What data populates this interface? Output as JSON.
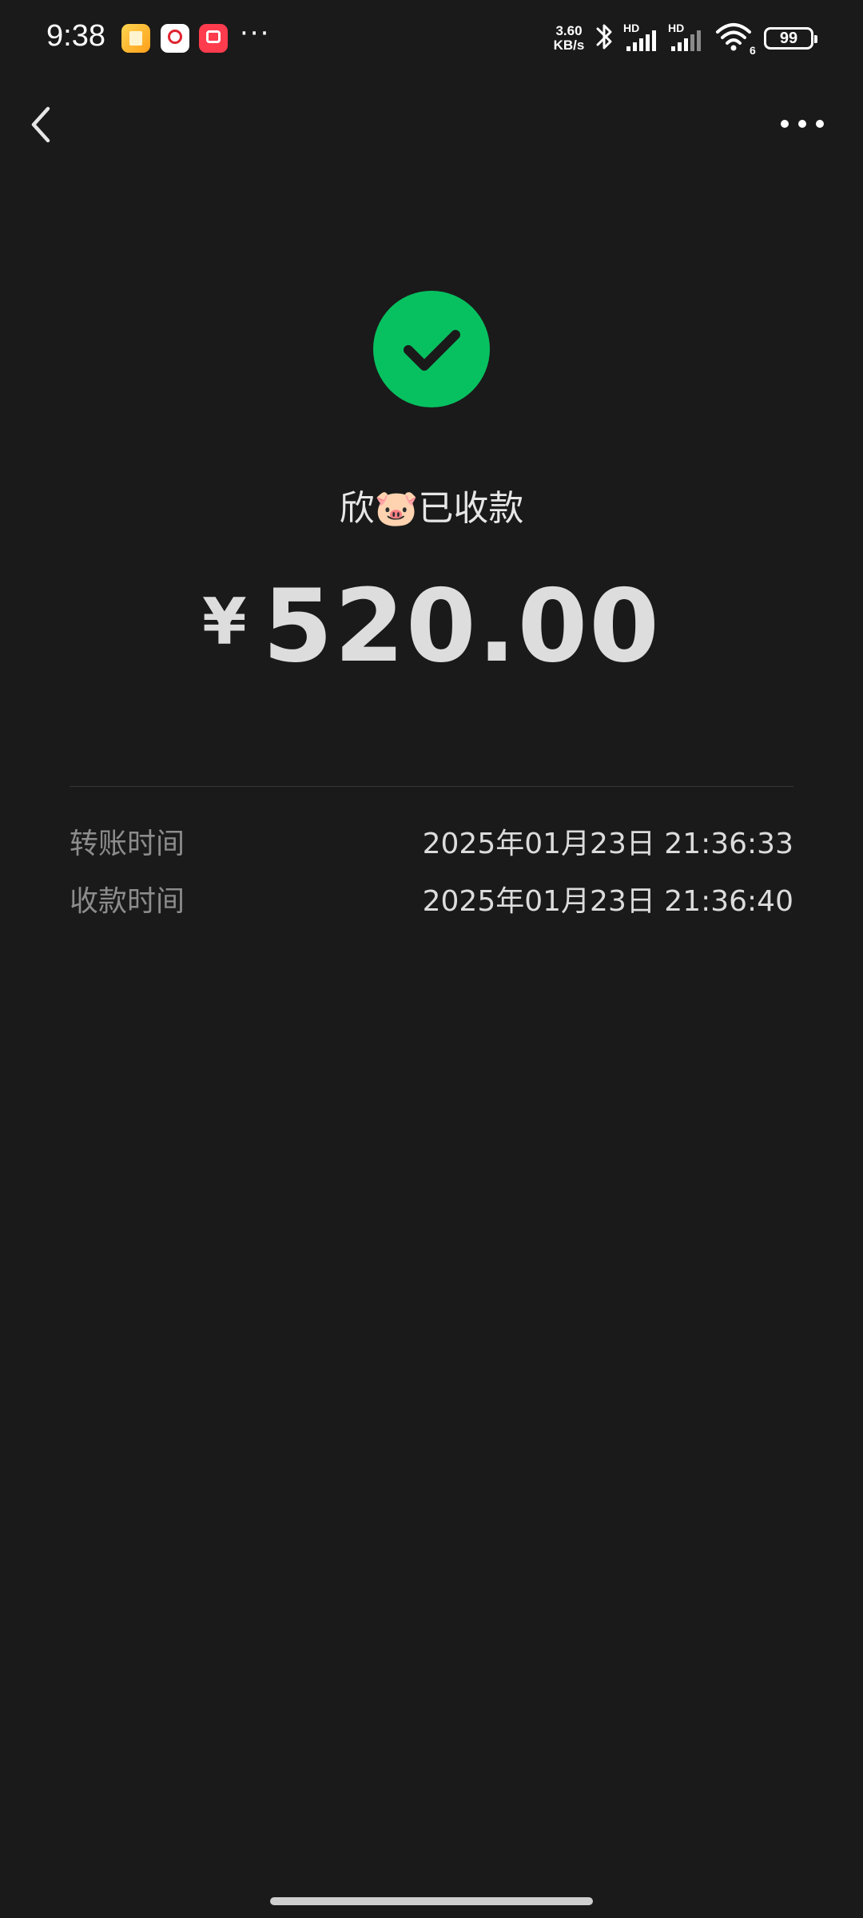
{
  "status_bar": {
    "time": "9:38",
    "more": "···",
    "net_speed_value": "3.60",
    "net_speed_unit": "KB/s",
    "signal_label_1": "HD",
    "signal_label_2": "HD",
    "wifi_badge": "6",
    "battery_level": "99",
    "app_icons": [
      "notes-app-icon",
      "china-unicom-icon",
      "video-app-icon"
    ]
  },
  "nav": {
    "back_icon": "chevron-left-icon",
    "more_icon": "more-dots-icon"
  },
  "result": {
    "icon": "check-circle-icon",
    "icon_color": "#07c160",
    "title_name": "欣🐷",
    "title_status": "已收款",
    "currency": "¥",
    "amount": "520.00"
  },
  "details": [
    {
      "label": "转账时间",
      "value": "2025年01月23日 21:36:33"
    },
    {
      "label": "收款时间",
      "value": "2025年01月23日 21:36:40"
    }
  ],
  "colors": {
    "background": "#1a1a1a",
    "accent_green": "#07c160"
  }
}
